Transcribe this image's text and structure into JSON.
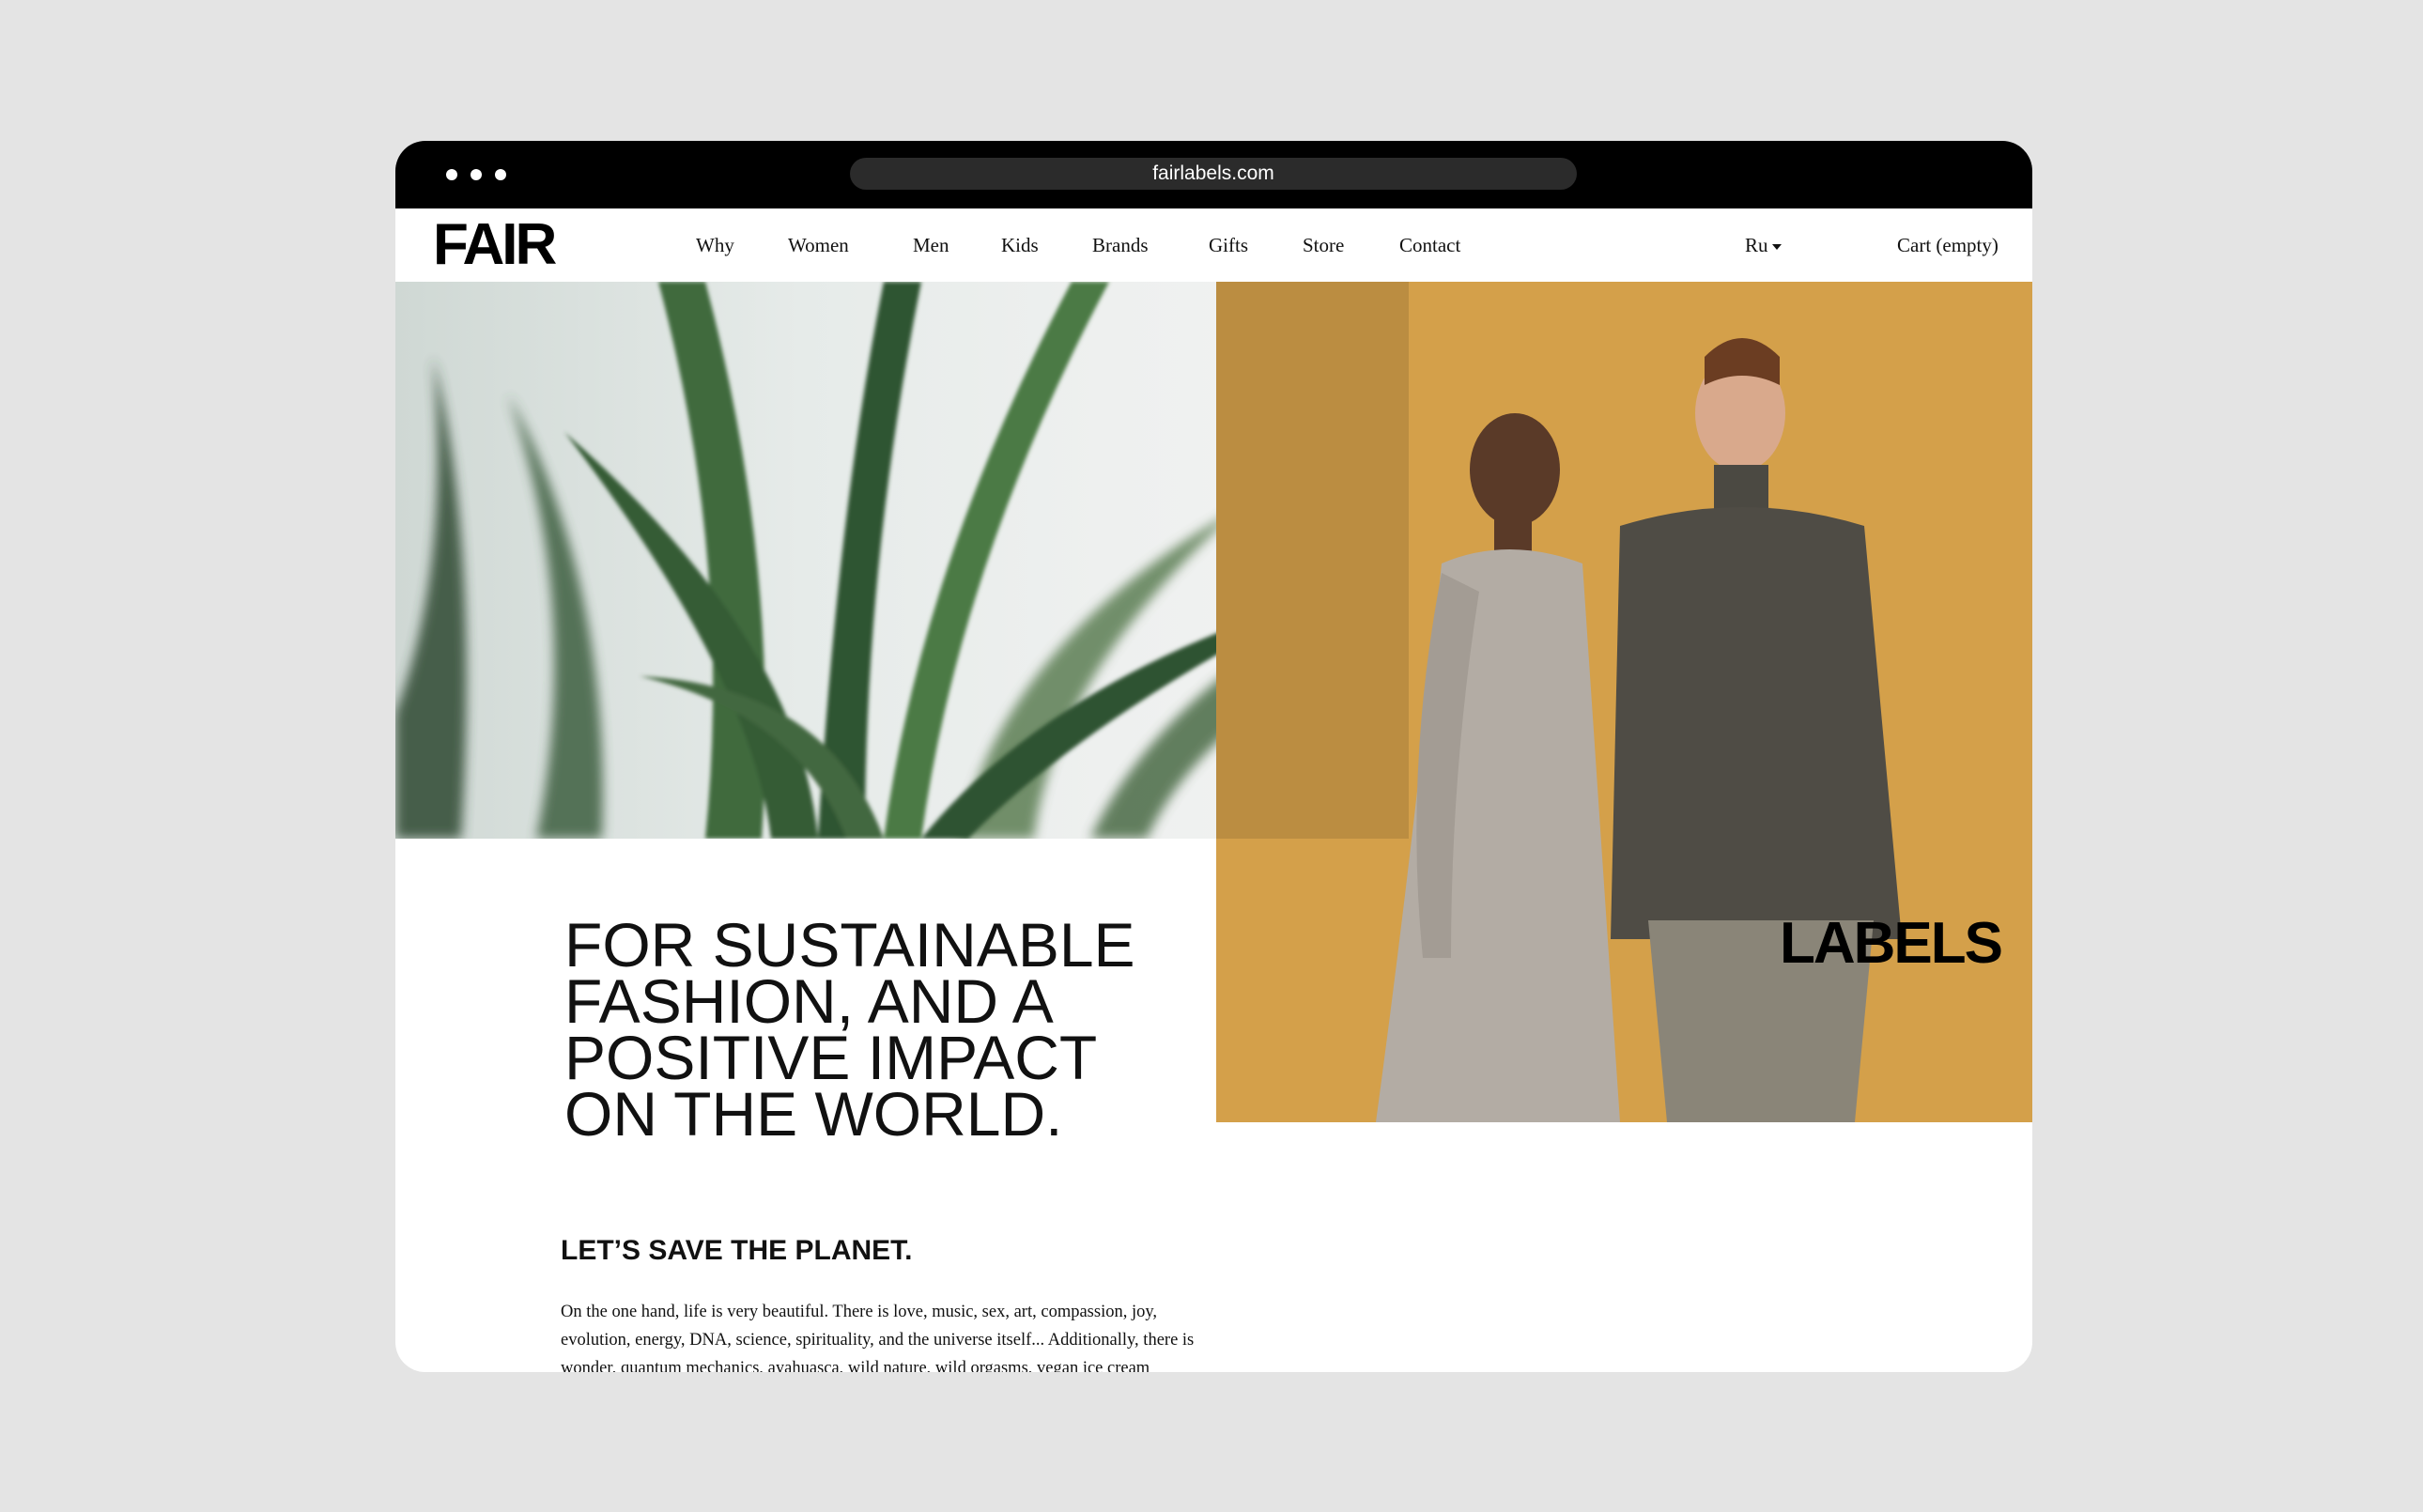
{
  "browser": {
    "url": "fairlabels.com"
  },
  "nav": {
    "logo": "FAIR",
    "items": [
      {
        "label": "Why"
      },
      {
        "label": "Women"
      },
      {
        "label": "Men"
      },
      {
        "label": "Kids"
      },
      {
        "label": "Brands"
      },
      {
        "label": "Gifts"
      },
      {
        "label": "Store"
      },
      {
        "label": "Contact"
      }
    ],
    "language": "Ru",
    "cart": "Cart (empty)"
  },
  "hero": {
    "headline": "FOR SUSTAINABLE FASHION, AND A POSITIVE IMPACT ON THE WORLD.",
    "overlay_label": "LABELS"
  },
  "intro": {
    "title": "LET’S SAVE THE PLANET.",
    "body": "On the one hand, life is very beautiful. There is love, music, sex, art, compassion, joy, evolution, energy, DNA, science, spirituality, and the universe itself... Additionally, there is wonder, quantum mechanics, ayahuasca, wild nature, wild orgasms, vegan ice cream"
  },
  "colors": {
    "background": "#e4e4e4",
    "titlebar": "#000000",
    "hero_ochre": "#d4a04a",
    "text": "#111111"
  }
}
